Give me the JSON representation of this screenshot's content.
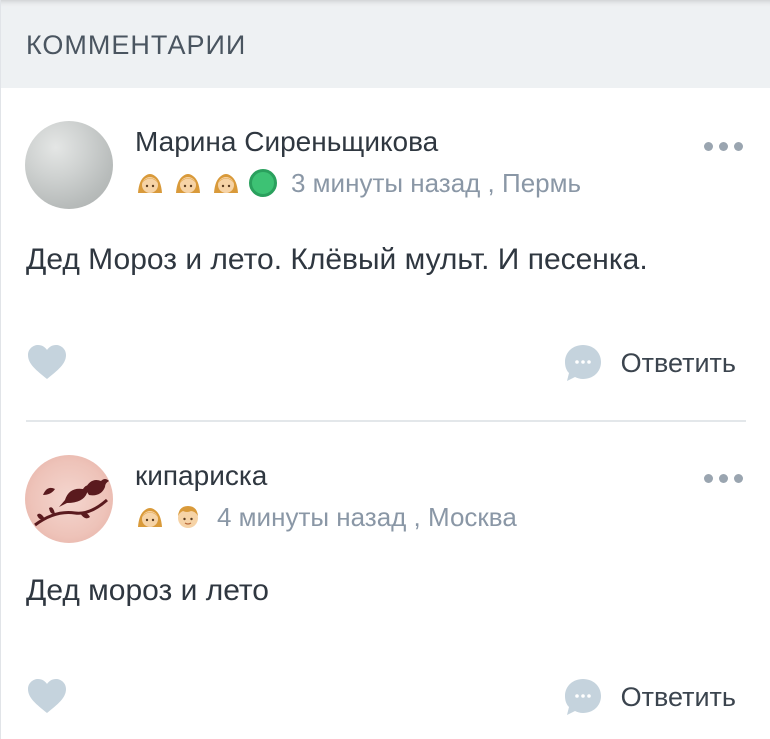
{
  "section": {
    "title": "КОММЕНТАРИИ"
  },
  "comments": [
    {
      "author": "Марина Сиреньщикова",
      "badges": [
        "girl-icon",
        "girl-icon",
        "girl-icon"
      ],
      "online": true,
      "time": "3 минуты назад",
      "location": "Пермь",
      "meta": "3 минуты назад , Пермь",
      "text": "Дед Мороз и лето. Клёвый мульт. И песенка.",
      "reply_label": "Ответить"
    },
    {
      "author": "кипариска",
      "badges": [
        "girl-icon",
        "boy-icon"
      ],
      "online": false,
      "time": "4 минуты назад",
      "location": "Москва",
      "meta": "4 минуты назад , Москва",
      "text": "Дед мороз и лето",
      "reply_label": "Ответить"
    }
  ],
  "colors": {
    "header_bg": "#eef1f3",
    "meta_text": "#8a97a6",
    "icon": "#c5d3dd",
    "online": "#3dc274"
  }
}
